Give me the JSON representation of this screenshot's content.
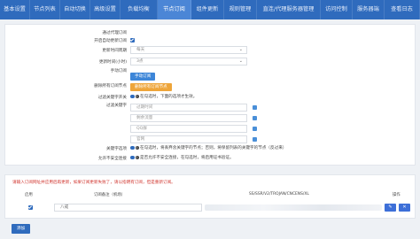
{
  "nav": {
    "tabs": [
      {
        "label": "基本设置",
        "active": false
      },
      {
        "label": "节点列表",
        "active": false
      },
      {
        "label": "自动切换",
        "active": false
      },
      {
        "label": "高级设置",
        "active": false
      },
      {
        "label": "负载均衡",
        "active": false
      },
      {
        "label": "节点订阅",
        "active": true
      },
      {
        "label": "组件更新",
        "active": false
      },
      {
        "label": "规则管理",
        "active": false
      },
      {
        "label": "直连/代理服务器管理",
        "active": false
      },
      {
        "label": "访问控制",
        "active": false
      },
      {
        "label": "服务器端",
        "active": false
      },
      {
        "label": "查看日志",
        "active": false
      }
    ]
  },
  "form": {
    "proxy_subscribe_label": "通过代理订阅",
    "auto_update_label": "开启自动更新订阅",
    "update_period_label": "更新时间周期",
    "update_period_value": "每天",
    "update_hour_label": "更新时间(小时)",
    "update_hour_value": "3点",
    "manual_subscribe_label": "手动订阅",
    "manual_subscribe_button": "手动订阅",
    "delete_all_label": "删除所有订阅节点",
    "delete_all_button": "删除所有订阅节点",
    "filter_keyword_label": "过滤关键字开关",
    "filter_keyword_help": "在勾选时，下面的选项才生效。",
    "filter_keyword_list_label": "过滤关键字",
    "filter_items": [
      "过期时间",
      "剩余流量",
      "QQ群",
      "官网"
    ],
    "keyword_mode_label": "关键字选项",
    "keyword_mode_help": "在勾选时，将丢弃含关键字的节点；否则，将保留列表的关键字的节点（反过来）",
    "allow_insecure_label": "允许不安全连接",
    "allow_insecure_help": "是否允许不安全连接，在勾选时，将启用证书验证。"
  },
  "subscriptions": {
    "warning": "请输入订阅网址并应用后再更新，如果订阅更新失败了，请以指明有订阅，但是重新订阅。",
    "headers": {
      "enabled": "启用",
      "remark": "订阅备注（机场）",
      "url": "SS/SSR/V2/TROJAN/CNCENS/XL",
      "action": "操作"
    },
    "rows": [
      {
        "remark": "八戒",
        "enabled": true
      }
    ],
    "add_button": "添加",
    "edit_label": "✎",
    "delete_label": "✕"
  },
  "colors": {
    "nav_bg": "#2f6bbd",
    "nav_active": "#4b86d6",
    "primary": "#3d86d8",
    "warning_button": "#eea53a",
    "warning_text": "#d0352e"
  }
}
